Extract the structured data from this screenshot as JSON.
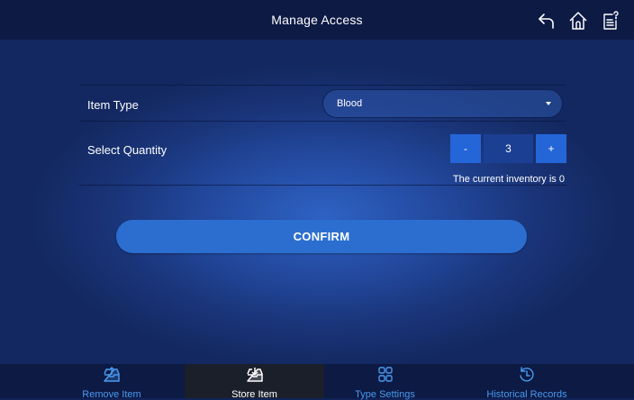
{
  "header": {
    "title": "Manage Access",
    "icons": [
      "back-arrow-icon",
      "home-icon",
      "clipboard-help-icon"
    ]
  },
  "form": {
    "item_type_label": "Item Type",
    "item_type_value": "Blood",
    "quantity_label": "Select Quantity",
    "decrement_label": "-",
    "quantity_value": "3",
    "increment_label": "+",
    "inventory_hint": "The current inventory is 0"
  },
  "confirm_label": "CONFIRM",
  "bottom_nav": {
    "items": [
      {
        "label": "Remove Item",
        "icon": "remove-item-icon",
        "active": false
      },
      {
        "label": "Store Item",
        "icon": "store-item-icon",
        "active": true
      },
      {
        "label": "Type Settings",
        "icon": "grid-icon",
        "active": false
      },
      {
        "label": "Historical Records",
        "icon": "history-icon",
        "active": false
      }
    ]
  },
  "colors": {
    "bar": "#0c1a44",
    "accent": "#2465d8",
    "nav_text": "#4a9af0",
    "active_nav_bg": "#1a1f2a"
  }
}
